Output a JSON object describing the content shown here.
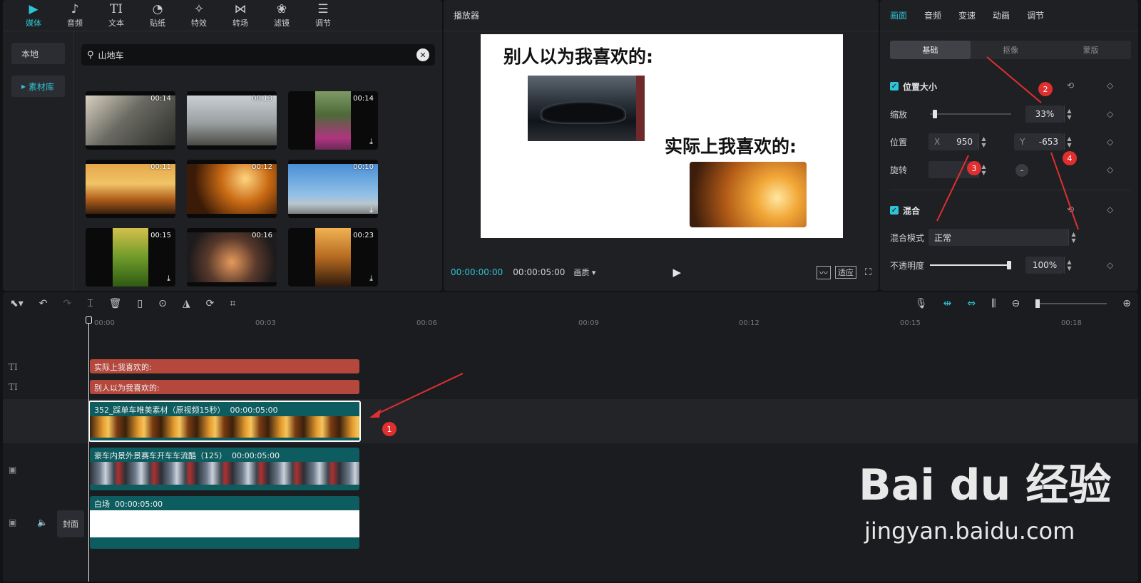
{
  "media": {
    "tabs": [
      {
        "label": "媒体",
        "icon": "play-square-icon"
      },
      {
        "label": "音频",
        "icon": "music-note-icon"
      },
      {
        "label": "文本",
        "icon": "text-icon"
      },
      {
        "label": "贴纸",
        "icon": "sticker-icon"
      },
      {
        "label": "特效",
        "icon": "sparkle-icon"
      },
      {
        "label": "转场",
        "icon": "transition-icon"
      },
      {
        "label": "滤镜",
        "icon": "filter-icon"
      },
      {
        "label": "调节",
        "icon": "sliders-icon"
      }
    ],
    "side": {
      "local": "本地",
      "library": "素材库"
    },
    "search": {
      "value": "山地车"
    },
    "thumbs": [
      {
        "dur": "00:14"
      },
      {
        "dur": "00:13"
      },
      {
        "dur": "00:14"
      },
      {
        "dur": "00:11"
      },
      {
        "dur": "00:12"
      },
      {
        "dur": "00:10"
      },
      {
        "dur": "00:15"
      },
      {
        "dur": "00:16"
      },
      {
        "dur": "00:23"
      }
    ]
  },
  "player": {
    "title": "播放器",
    "caption1": "别人以为我喜欢的:",
    "caption2": "实际上我喜欢的:",
    "time_current": "00:00:00:00",
    "time_total": "00:00:05:00",
    "quality": "画质",
    "fit": "适应"
  },
  "props": {
    "tabs": [
      "画面",
      "音频",
      "变速",
      "动画",
      "调节"
    ],
    "subtabs": [
      "基础",
      "抠像",
      "蒙版"
    ],
    "section_position": "位置大小",
    "scale_label": "缩放",
    "scale_value": "33%",
    "position_label": "位置",
    "x_label": "X",
    "x_value": "950",
    "y_label": "Y",
    "y_value": "-653",
    "rotate_label": "旋转",
    "rotate_value": "0",
    "section_blend": "混合",
    "blend_mode_label": "混合模式",
    "blend_mode_value": "正常",
    "opacity_label": "不透明度",
    "opacity_value": "100%",
    "scale_fraction": 0.33,
    "opacity_fraction": 1.0
  },
  "annotations": {
    "b1": "1",
    "b2": "2",
    "b3": "3",
    "b4": "4"
  },
  "timeline": {
    "ruler": [
      "00:00",
      "00:03",
      "00:06",
      "00:09",
      "00:12",
      "00:15",
      "00:18"
    ],
    "text_clip1": "实际上我喜欢的:",
    "text_clip2": "别人以为我喜欢的:",
    "video_clip1_name": "352_踩单车唯美素材（原视频15秒）",
    "video_clip1_dur": "00:00:05:00",
    "video_clip2_name": "豪车内景外景赛车开车车流酷（125）",
    "video_clip2_dur": "00:00:05:00",
    "white_clip_name": "白场",
    "white_clip_dur": "00:00:05:00",
    "cover_label": "封面"
  },
  "watermark": {
    "brand": "Bai du 经验",
    "url": "jingyan.baidu.com"
  },
  "colors": {
    "accent": "#2ec3d6",
    "text_clip": "#b5483d",
    "video_track": "#0d5c5f",
    "badge": "#e02f2f"
  }
}
